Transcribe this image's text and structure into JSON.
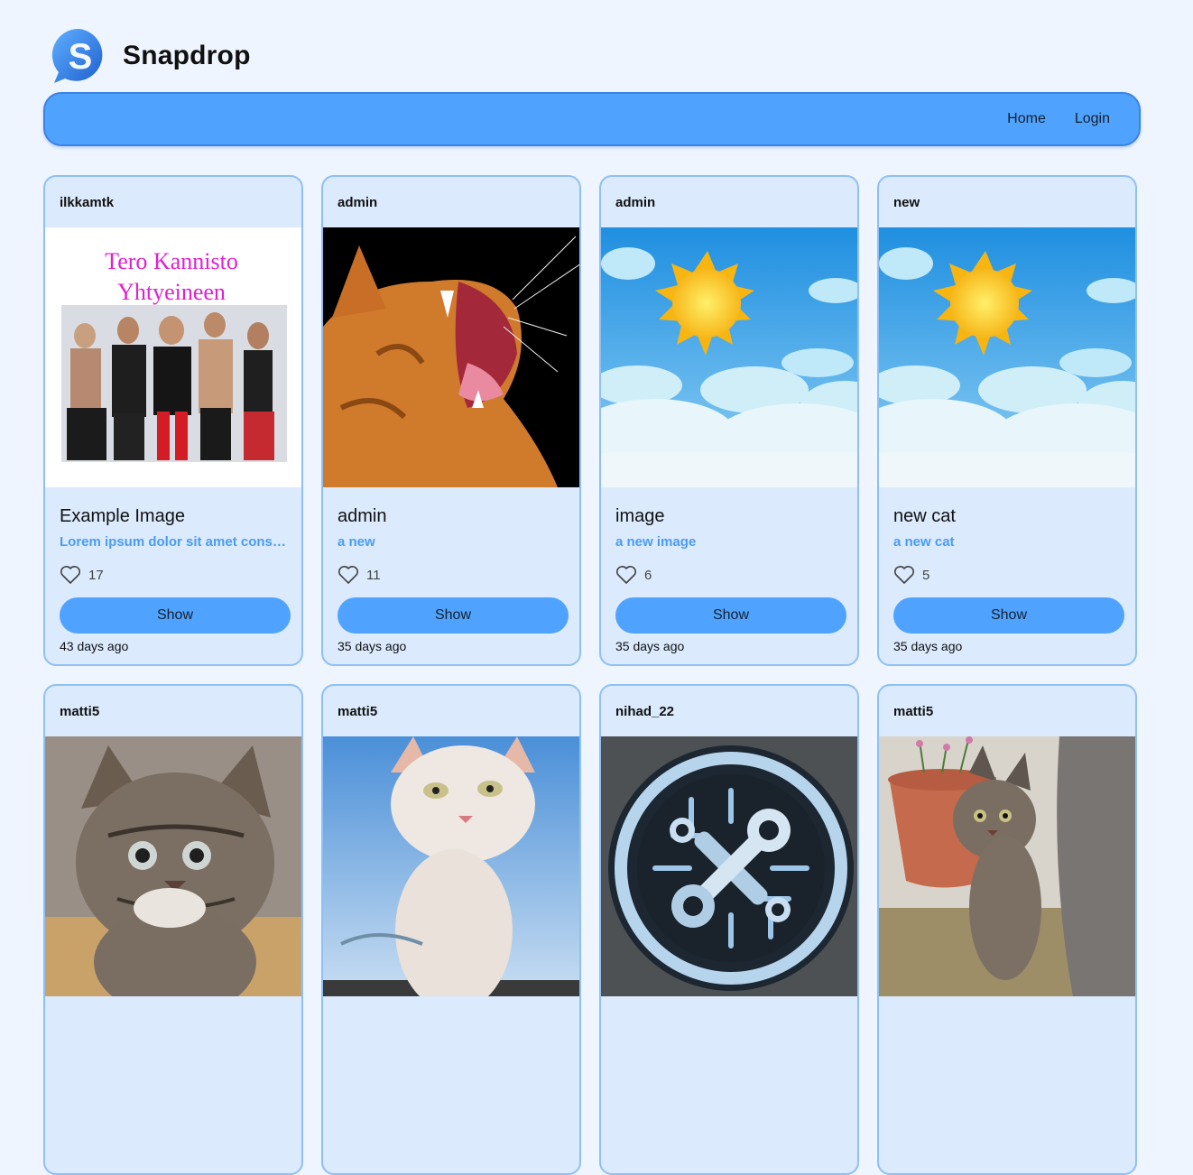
{
  "app": {
    "name": "Snapdrop",
    "logo_icon": "snapdrop-logo-icon"
  },
  "nav": {
    "home": "Home",
    "login": "Login"
  },
  "colors": {
    "background": "#eef5fe",
    "navbar": "#4fa3ff",
    "card": "#dbeafd",
    "accent": "#4a9cf2"
  },
  "posts": [
    {
      "user": "ilkkamtk",
      "image_icon": "band-photo-image",
      "image_text_1": "Tero Kannisto",
      "image_text_2": "Yhtyeineen",
      "title": "Example Image",
      "description": "Lorem ipsum dolor sit amet consectetur adipiscing elit",
      "likes": "17",
      "button": "Show",
      "date": "43 days ago"
    },
    {
      "user": "admin",
      "image_icon": "yawning-cat-image",
      "title": "admin",
      "description": "a new",
      "likes": "11",
      "button": "Show",
      "date": "35 days ago"
    },
    {
      "user": "admin",
      "image_icon": "sun-clouds-image",
      "title": "image",
      "description": "a new image",
      "likes": "6",
      "button": "Show",
      "date": "35 days ago"
    },
    {
      "user": "new",
      "image_icon": "sun-clouds-image",
      "title": "new cat",
      "description": "a new cat",
      "likes": "5",
      "button": "Show",
      "date": "35 days ago"
    },
    {
      "user": "matti5",
      "image_icon": "tabby-kitten-image"
    },
    {
      "user": "matti5",
      "image_icon": "white-kitten-image"
    },
    {
      "user": "nihad_22",
      "image_icon": "wrench-circuit-logo-image"
    },
    {
      "user": "matti5",
      "image_icon": "kitten-flowerpot-image"
    }
  ]
}
